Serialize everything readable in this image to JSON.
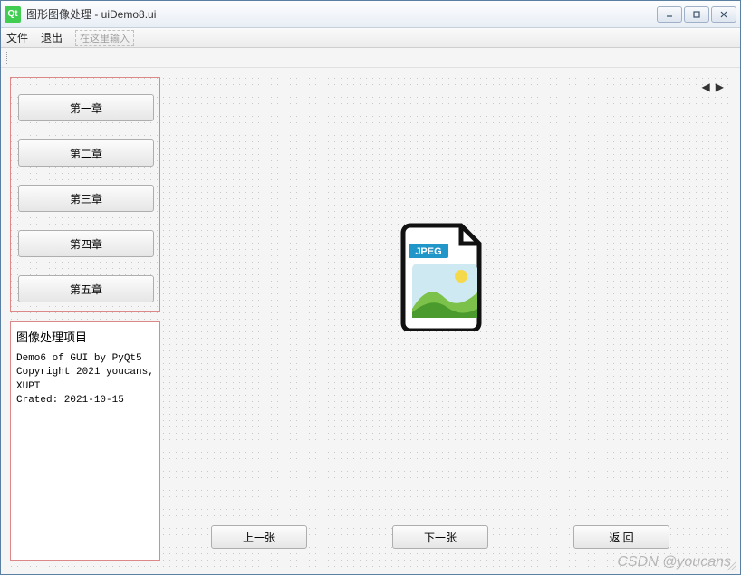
{
  "window": {
    "title": "图形图像处理 - uiDemo8.ui",
    "logo_text": "Qt"
  },
  "menubar": {
    "file": "文件",
    "exit": "退出",
    "placeholder": "在这里输入"
  },
  "chapters": {
    "c1": "第一章",
    "c2": "第二章",
    "c3": "第三章",
    "c4": "第四章",
    "c5": "第五章"
  },
  "info": {
    "title": "图像处理项目",
    "body": "Demo6 of GUI by PyQt5\nCopyright 2021 youcans, XUPT\nCrated: 2021-10-15"
  },
  "bottom": {
    "prev": "上一张",
    "next": "下一张",
    "back": "返 回"
  },
  "image_badge": "JPEG",
  "watermark": "CSDN @youcans"
}
